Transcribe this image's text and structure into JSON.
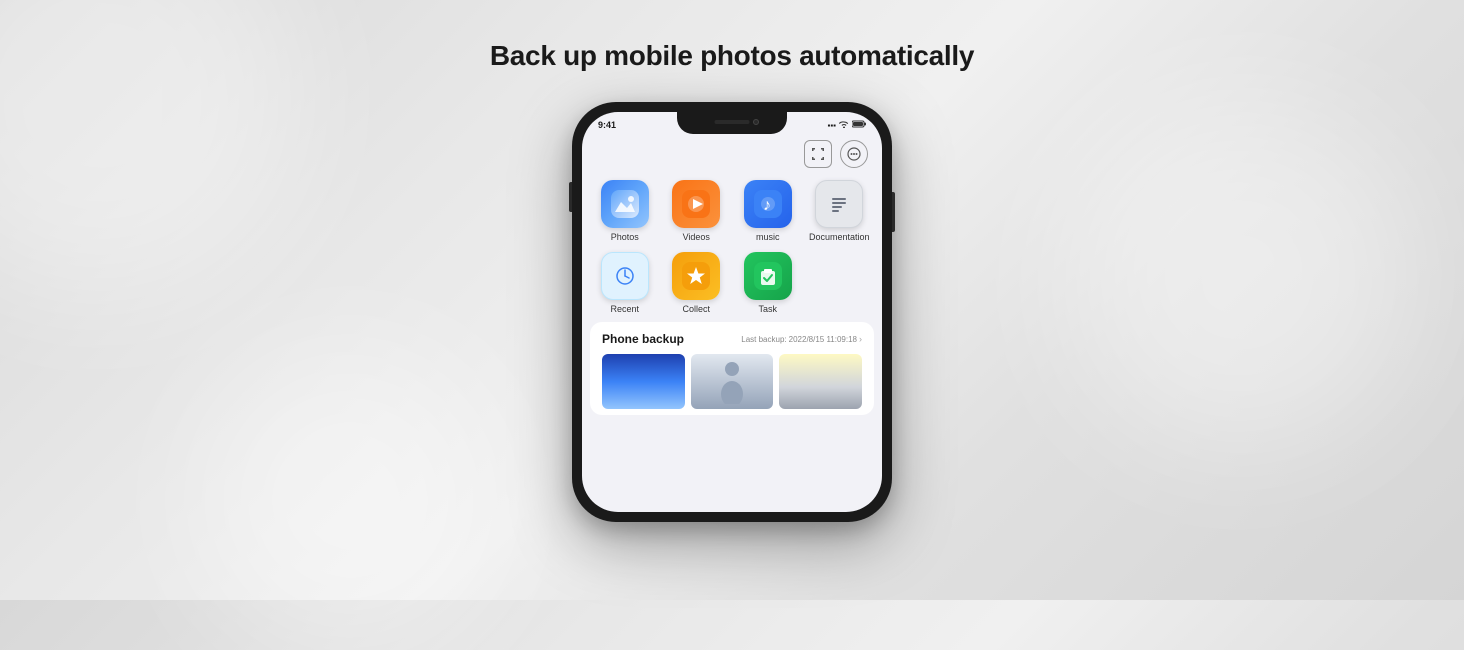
{
  "page": {
    "title": "Back up mobile photos automatically",
    "background": "#e5e5e5"
  },
  "phone": {
    "status_bar": {
      "time_left": "9:41",
      "time_right": "9:41",
      "signal": "●●●",
      "wifi": "WiFi",
      "battery": "100%"
    },
    "top_icons": [
      {
        "name": "scan-icon",
        "symbol": "⬜"
      },
      {
        "name": "chat-icon",
        "symbol": "💬"
      }
    ],
    "apps": [
      {
        "id": "photos",
        "label": "Photos",
        "icon_class": "app-icon-photos",
        "color": "#3b82f6"
      },
      {
        "id": "videos",
        "label": "Videos",
        "icon_class": "app-icon-videos",
        "color": "#f97316"
      },
      {
        "id": "music",
        "label": "music",
        "icon_class": "app-icon-music",
        "color": "#3b82f6"
      },
      {
        "id": "docs",
        "label": "Documentation",
        "icon_class": "app-icon-docs",
        "color": "#6b7280"
      },
      {
        "id": "recent",
        "label": "Recent",
        "icon_class": "app-icon-recent",
        "color": "#3b82f6"
      },
      {
        "id": "collect",
        "label": "Collect",
        "icon_class": "app-icon-collect",
        "color": "#f59e0b"
      },
      {
        "id": "task",
        "label": "Task",
        "icon_class": "app-icon-task",
        "color": "#22c55e"
      }
    ],
    "backup_section": {
      "title": "Phone backup",
      "last_backup_label": "Last backup:",
      "last_backup_time": "2022/8/15 11:09:18"
    }
  }
}
